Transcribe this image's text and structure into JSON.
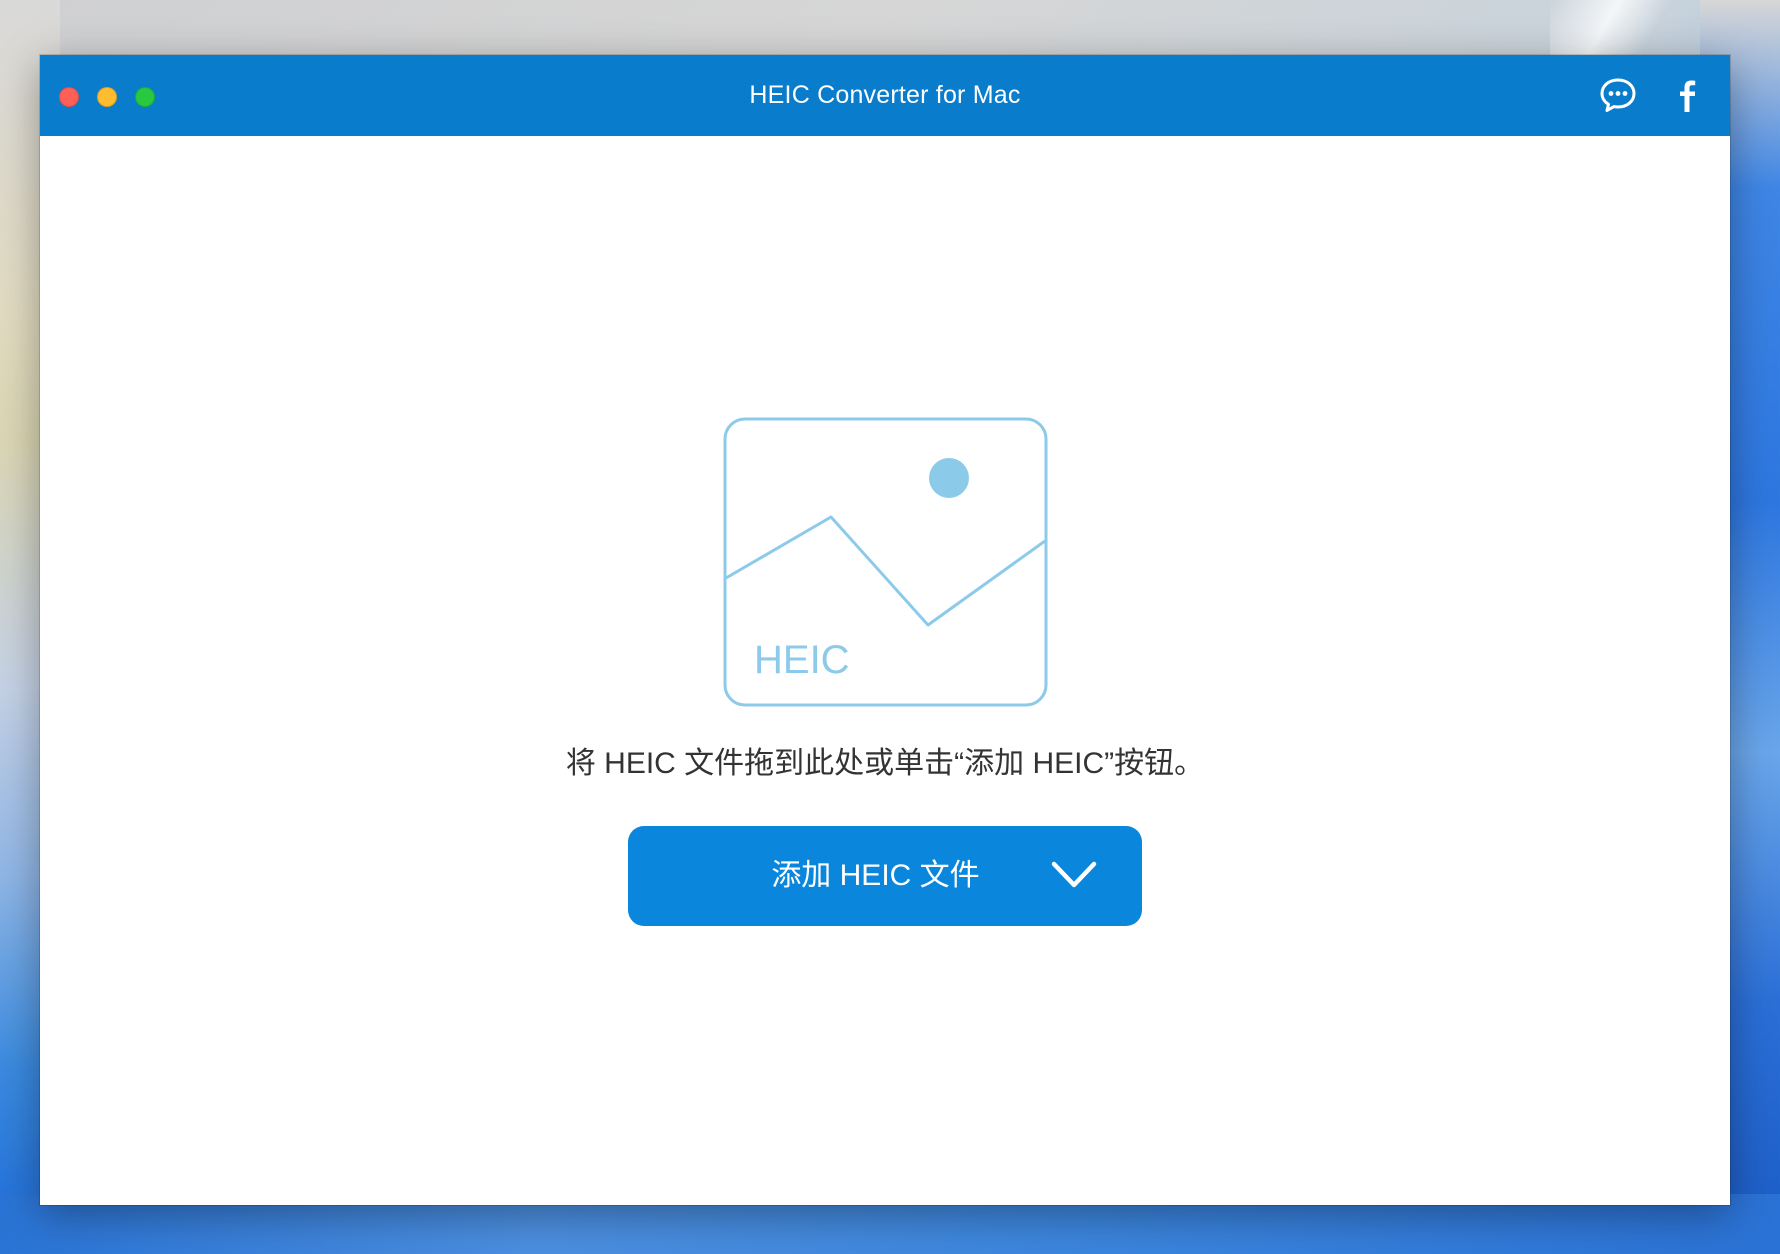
{
  "window": {
    "title": "HEIC Converter for Mac"
  },
  "titlebar": {
    "icons": [
      "chat-bubble-icon",
      "facebook-icon"
    ]
  },
  "dropzone": {
    "image_label": "HEIC",
    "hint": "将 HEIC 文件拖到此处或单击“添加 HEIC”按钮。"
  },
  "add_button": {
    "label": "添加 HEIC 文件",
    "dropdown_icon": "chevron-down-icon"
  },
  "colors": {
    "titlebar": "#0a7ccc",
    "button": "#0a87dc",
    "illustration": "#8ccaea",
    "hint_text": "#333333"
  }
}
